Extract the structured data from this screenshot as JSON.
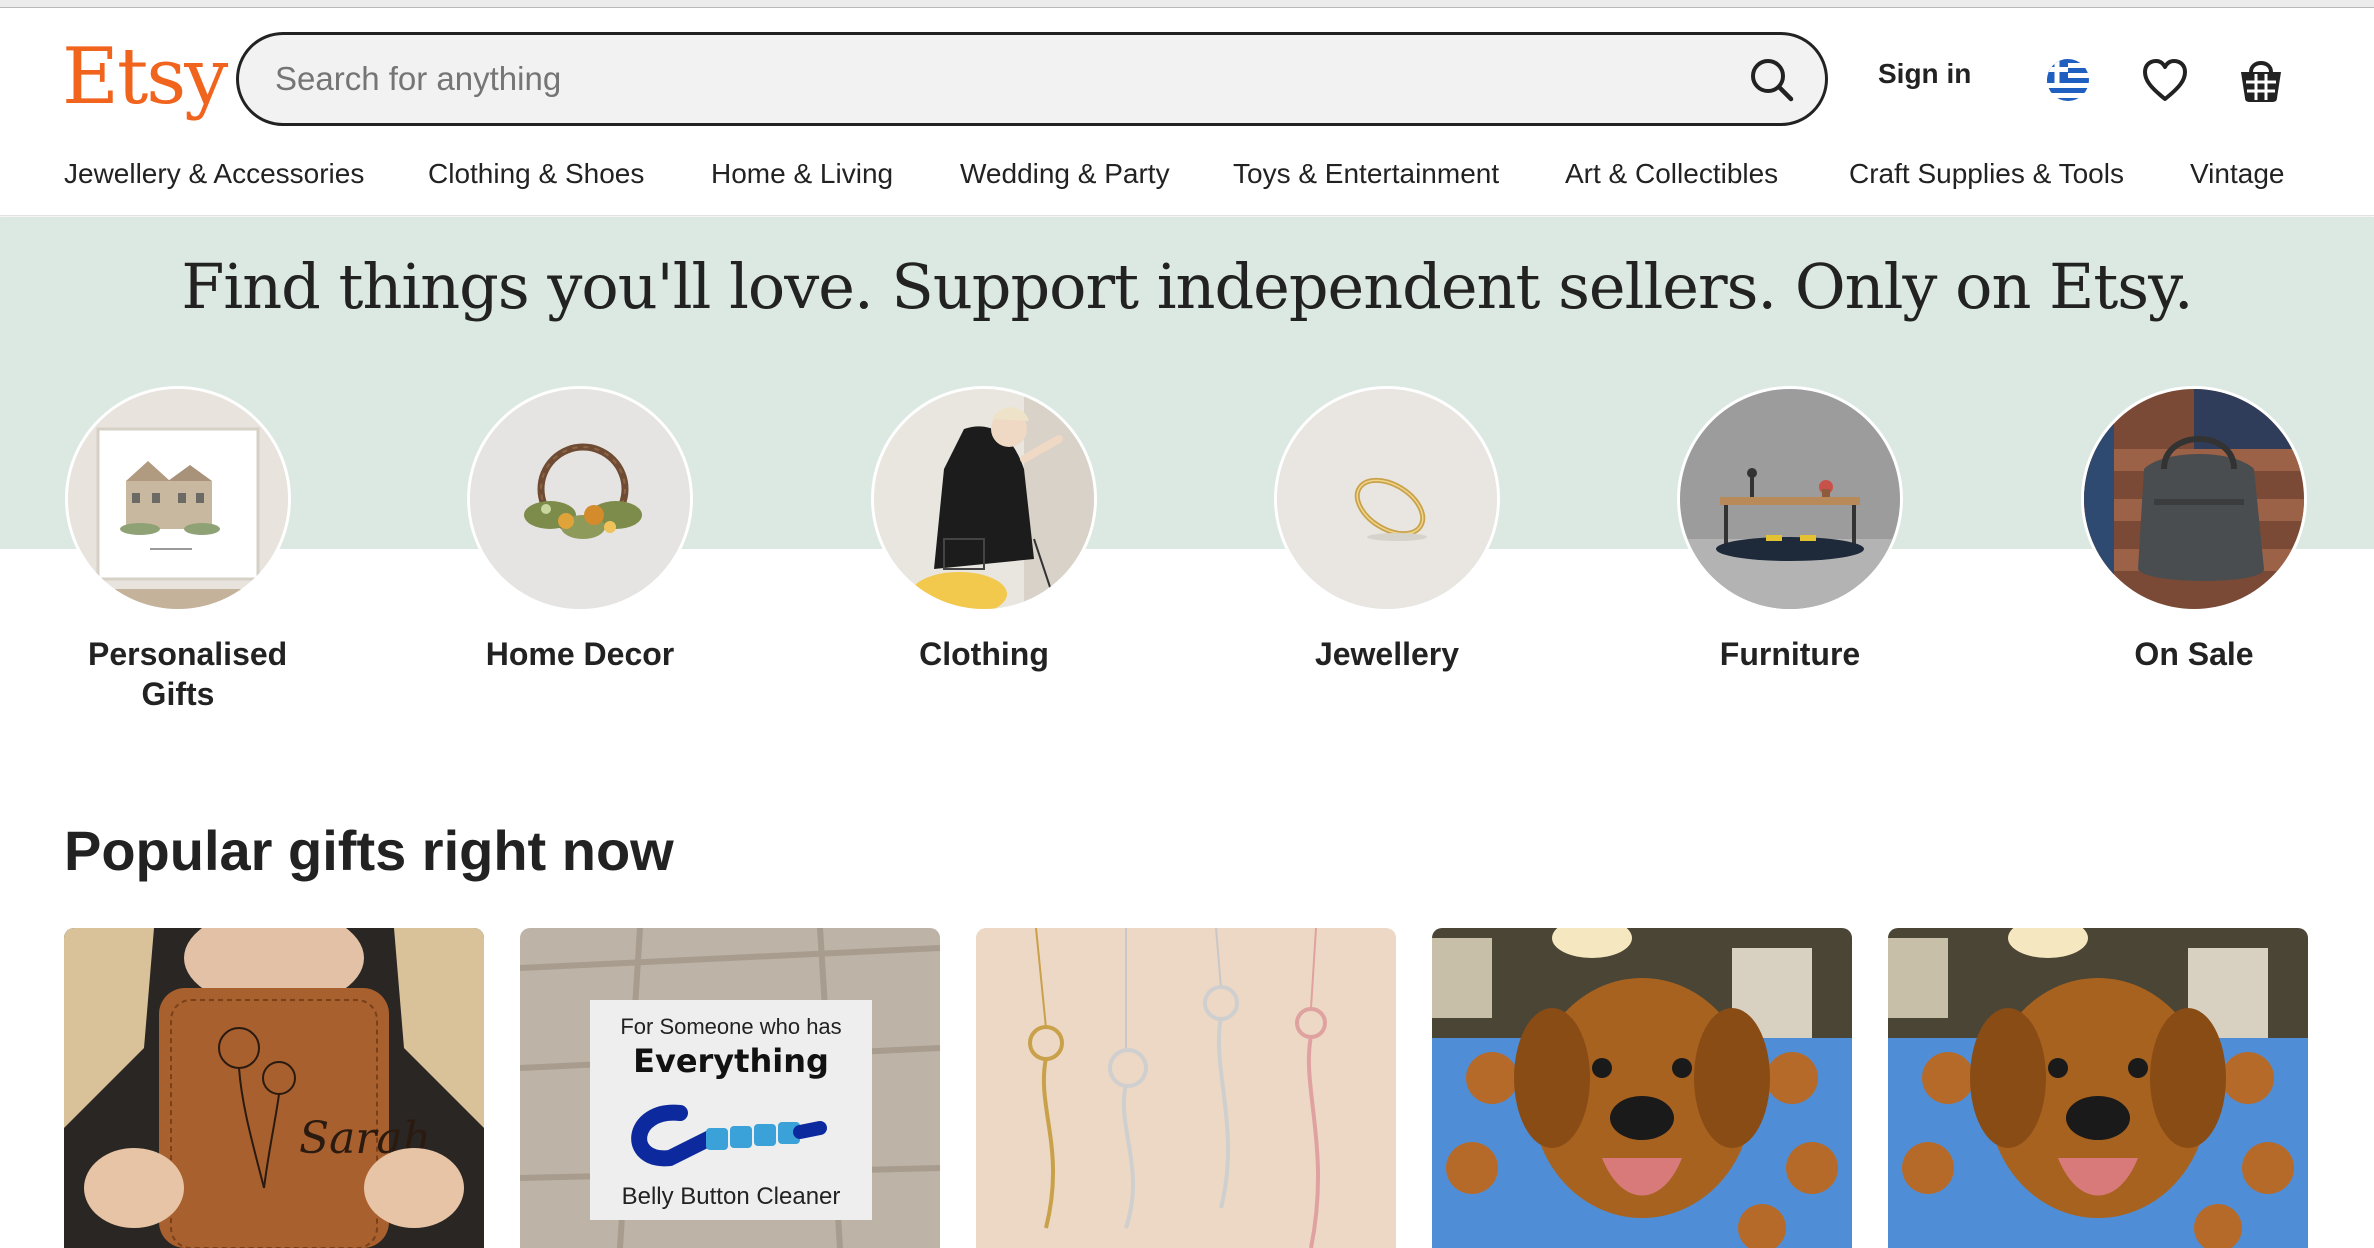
{
  "header": {
    "logo": "Etsy",
    "search_placeholder": "Search for anything",
    "sign_in": "Sign in",
    "icons": [
      "search-icon",
      "greece-flag-icon",
      "heart-icon",
      "basket-icon"
    ]
  },
  "nav": {
    "items": [
      "Jewellery & Accessories",
      "Clothing & Shoes",
      "Home & Living",
      "Wedding & Party",
      "Toys & Entertainment",
      "Art & Collectibles",
      "Craft Supplies & Tools",
      "Vintage"
    ]
  },
  "hero": {
    "title": "Find things you'll love. Support independent sellers. Only on Etsy.",
    "categories": [
      {
        "label": "Personalised Gifts"
      },
      {
        "label": "Home Decor"
      },
      {
        "label": "Clothing"
      },
      {
        "label": "Jewellery"
      },
      {
        "label": "Furniture"
      },
      {
        "label": "On Sale"
      }
    ]
  },
  "popular": {
    "title": "Popular gifts right now",
    "cards": [
      {
        "image": "leather jewellery box engraved with flower and name",
        "engraving": "Sarah"
      },
      {
        "image": "novelty card with blue pipe cleaner",
        "card_line1": "For Someone who has",
        "card_line2": "Everything",
        "card_line3": "Belly Button Cleaner"
      },
      {
        "image": "birth flower name necklaces"
      },
      {
        "image": "golden retriever with custom face pillow"
      },
      {
        "image": "golden retriever with custom face pillow"
      }
    ]
  },
  "colors": {
    "brand": "#F1641E",
    "hero_bg": "#dce9e3",
    "text": "#222222"
  }
}
